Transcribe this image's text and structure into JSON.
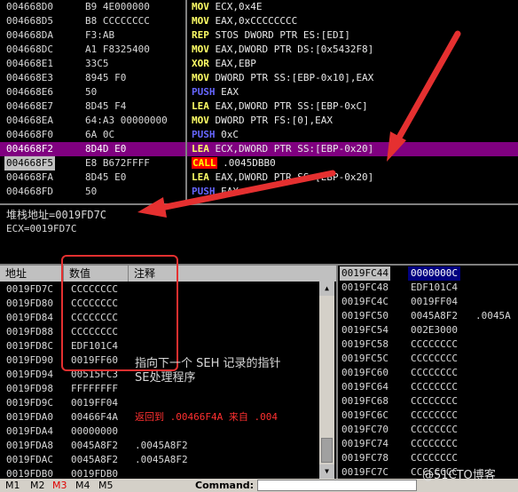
{
  "disassembly": {
    "rows": [
      {
        "addr": "004668D0",
        "hex": "B9 4E000000",
        "mn": "MOV",
        "ops": " ECX,0x4E",
        "mncls": "mov"
      },
      {
        "addr": "004668D5",
        "hex": "B8 CCCCCCCC",
        "mn": "MOV",
        "ops": " EAX,0xCCCCCCCC",
        "mncls": "mov"
      },
      {
        "addr": "004668DA",
        "hex": "F3:AB",
        "mn": "REP",
        "ops": " STOS DWORD PTR ES:[EDI]",
        "mncls": "rep"
      },
      {
        "addr": "004668DC",
        "hex": "A1 F8325400",
        "mn": "MOV",
        "ops": " EAX,DWORD PTR DS:[0x5432F8]",
        "mncls": "mov"
      },
      {
        "addr": "004668E1",
        "hex": "33C5",
        "mn": "XOR",
        "ops": " EAX,EBP",
        "mncls": "xor"
      },
      {
        "addr": "004668E3",
        "hex": "8945 F0",
        "mn": "MOV",
        "ops": " DWORD PTR SS:[EBP-0x10],EAX",
        "mncls": "mov"
      },
      {
        "addr": "004668E6",
        "hex": "50",
        "mn": "PUSH",
        "ops": " EAX",
        "mncls": "push"
      },
      {
        "addr": "004668E7",
        "hex": "8D45 F4",
        "mn": "LEA",
        "ops": " EAX,DWORD PTR SS:[EBP-0xC]",
        "mncls": "lea"
      },
      {
        "addr": "004668EA",
        "hex": "64:A3 00000000",
        "mn": "MOV",
        "ops": " DWORD PTR FS:[0],EAX",
        "mncls": "mov"
      },
      {
        "addr": "004668F0",
        "hex": "6A 0C",
        "mn": "PUSH",
        "ops": " 0xC",
        "mncls": "push"
      },
      {
        "addr": "004668F2",
        "hex": "8D4D E0",
        "mn": "LEA",
        "ops": " ECX,DWORD PTR SS:[EBP-0x20]",
        "mncls": "lea",
        "selected": true
      },
      {
        "addr": "004668F5",
        "hex": "E8 B672FFFF",
        "mn": "CALL",
        "ops": " .0045DBB0",
        "mncls": "call",
        "current": true
      },
      {
        "addr": "004668FA",
        "hex": "8D45 E0",
        "mn": "LEA",
        "ops": " EAX,DWORD PTR SS:[EBP-0x20]",
        "mncls": "lea"
      },
      {
        "addr": "004668FD",
        "hex": "50",
        "mn": "PUSH",
        "ops": " EAX",
        "mncls": "push"
      }
    ]
  },
  "info": {
    "line1": "堆栈地址=0019FD7C",
    "line2": "ECX=0019FD7C"
  },
  "dump": {
    "header": {
      "addr": "地址",
      "value": "数值",
      "comment": "注释"
    },
    "rows": [
      {
        "addr": "0019FD7C",
        "val": "CCCCCCCC",
        "cmt": ""
      },
      {
        "addr": "0019FD80",
        "val": "CCCCCCCC",
        "cmt": ""
      },
      {
        "addr": "0019FD84",
        "val": "CCCCCCCC",
        "cmt": ""
      },
      {
        "addr": "0019FD88",
        "val": "CCCCCCCC",
        "cmt": ""
      },
      {
        "addr": "0019FD8C",
        "val": "EDF101C4",
        "cmt": ""
      },
      {
        "addr": "0019FD90",
        "val": "0019FF60",
        "cmt": ""
      },
      {
        "addr": "0019FD94",
        "val": "00515FC3",
        "cmt": ""
      },
      {
        "addr": "0019FD98",
        "val": "FFFFFFFF",
        "cmt": ""
      },
      {
        "addr": "0019FD9C",
        "val": "0019FF04",
        "cmt": ""
      },
      {
        "addr": "0019FDA0",
        "val": "00466F4A",
        "cmt": "返回到 .00466F4A 来自 .004",
        "red": true
      },
      {
        "addr": "0019FDA4",
        "val": "00000000",
        "cmt": ""
      },
      {
        "addr": "0019FDA8",
        "val": "0045A8F2",
        "cmt": ".0045A8F2"
      },
      {
        "addr": "0019FDAC",
        "val": "0045A8F2",
        "cmt": ".0045A8F2"
      },
      {
        "addr": "0019FDB0",
        "val": "0019FDB0",
        "cmt": ""
      }
    ],
    "annotation_line1": "指向下一个 SEH 记录的指针",
    "annotation_line2": "SE处理程序"
  },
  "stack": {
    "rows": [
      {
        "addr": "0019FC44",
        "val": "0000000C",
        "cmt": "",
        "top": true
      },
      {
        "addr": "0019FC48",
        "val": "EDF101C4",
        "cmt": ""
      },
      {
        "addr": "0019FC4C",
        "val": "0019FF04",
        "cmt": ""
      },
      {
        "addr": "0019FC50",
        "val": "0045A8F2",
        "cmt": ".0045A"
      },
      {
        "addr": "0019FC54",
        "val": "002E3000",
        "cmt": ""
      },
      {
        "addr": "0019FC58",
        "val": "CCCCCCCC",
        "cmt": ""
      },
      {
        "addr": "0019FC5C",
        "val": "CCCCCCCC",
        "cmt": ""
      },
      {
        "addr": "0019FC60",
        "val": "CCCCCCCC",
        "cmt": ""
      },
      {
        "addr": "0019FC64",
        "val": "CCCCCCCC",
        "cmt": ""
      },
      {
        "addr": "0019FC68",
        "val": "CCCCCCCC",
        "cmt": ""
      },
      {
        "addr": "0019FC6C",
        "val": "CCCCCCCC",
        "cmt": ""
      },
      {
        "addr": "0019FC70",
        "val": "CCCCCCCC",
        "cmt": ""
      },
      {
        "addr": "0019FC74",
        "val": "CCCCCCCC",
        "cmt": ""
      },
      {
        "addr": "0019FC78",
        "val": "CCCCCCCC",
        "cmt": ""
      },
      {
        "addr": "0019FC7C",
        "val": "CCCCCCCC",
        "cmt": ""
      }
    ]
  },
  "bottombar": {
    "tabs": [
      {
        "label": "M1",
        "active": false
      },
      {
        "label": "M2",
        "active": false
      },
      {
        "label": "M3",
        "active": true
      },
      {
        "label": "M4",
        "active": false
      },
      {
        "label": "M5",
        "active": false
      }
    ],
    "command_label": "Command:",
    "command_value": ""
  },
  "watermark": "@51CTO博客",
  "colors": {
    "selected_row": "#800080",
    "annotation_red": "#e53030",
    "mnemonic_yellow": "#ffff66",
    "push_blue": "#6666ff",
    "call_bg": "#ff0000"
  }
}
